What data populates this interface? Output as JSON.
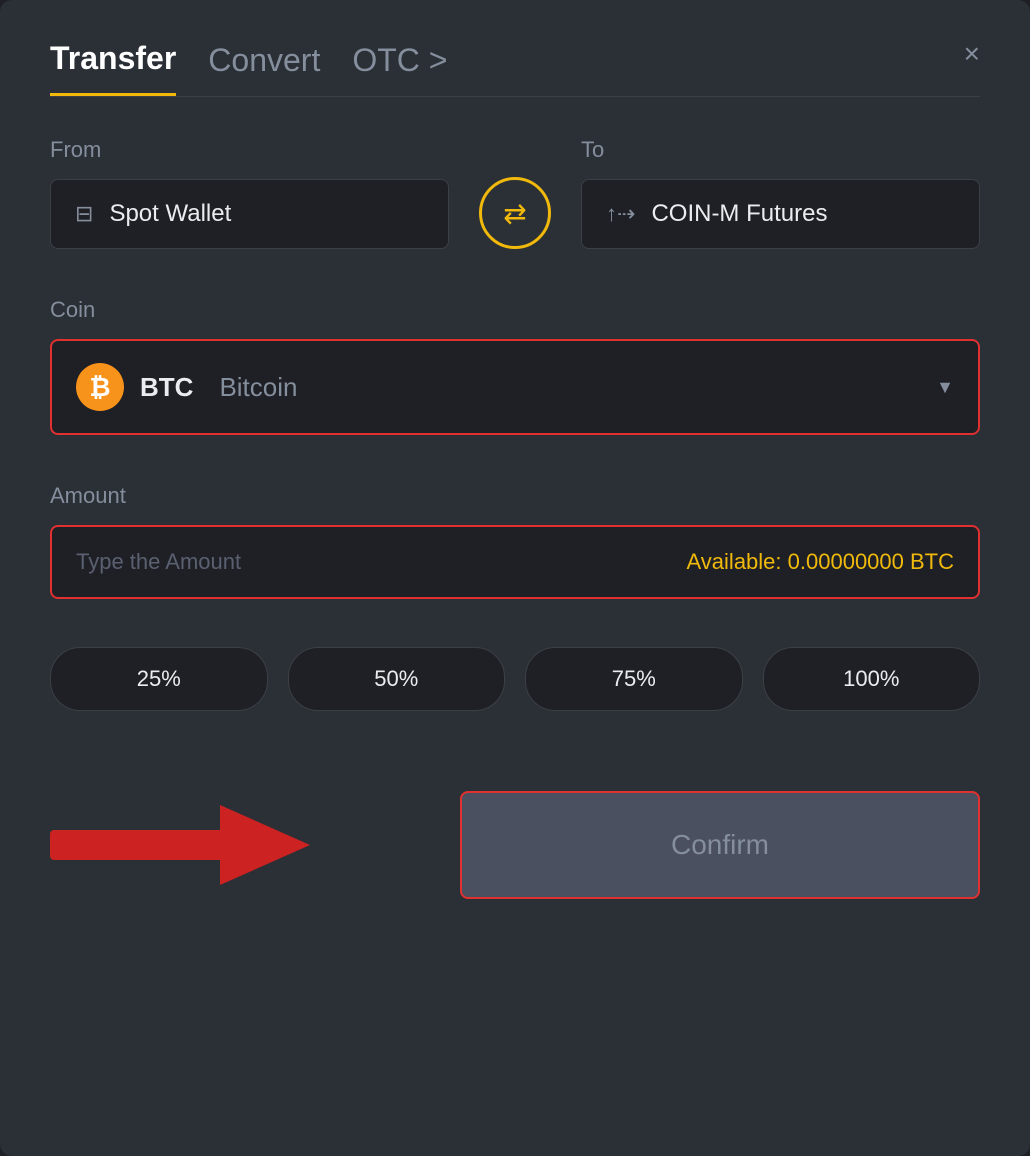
{
  "modal": {
    "title": "Transfer",
    "tabs": [
      {
        "label": "Transfer",
        "active": true
      },
      {
        "label": "Convert",
        "active": false
      },
      {
        "label": "OTC >",
        "active": false
      }
    ],
    "close_label": "×",
    "from_label": "From",
    "to_label": "To",
    "from_wallet": "Spot Wallet",
    "to_wallet": "COIN-M Futures",
    "coin_label": "Coin",
    "coin_ticker": "BTC",
    "coin_name": "Bitcoin",
    "amount_label": "Amount",
    "amount_placeholder": "Type the Amount",
    "available_label": "Available:",
    "available_value": "0.00000000 BTC",
    "percent_buttons": [
      "25%",
      "50%",
      "75%",
      "100%"
    ],
    "confirm_label": "Confirm"
  }
}
